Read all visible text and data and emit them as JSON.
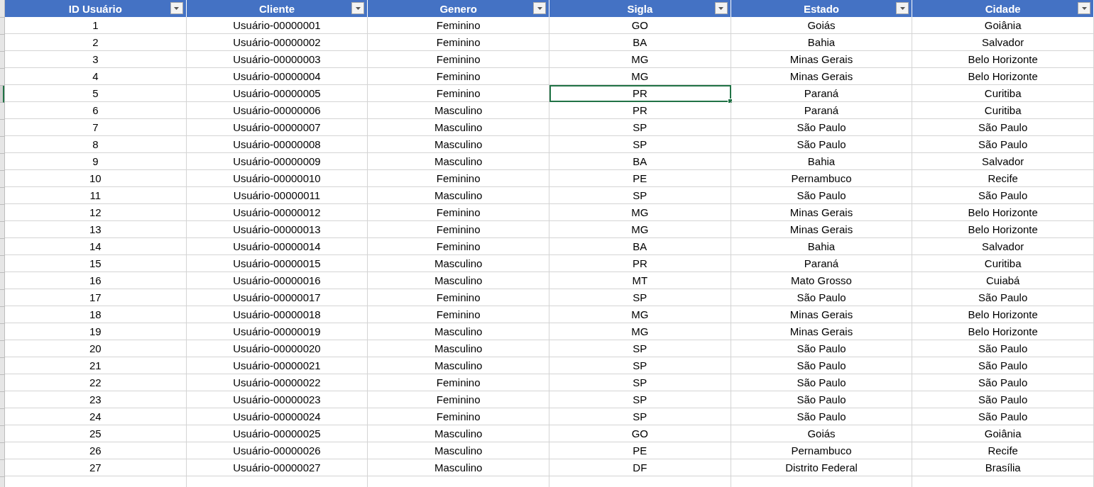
{
  "table": {
    "columns": [
      {
        "label": "ID Usuário",
        "selected": false
      },
      {
        "label": "Cliente",
        "selected": false
      },
      {
        "label": "Genero",
        "selected": false
      },
      {
        "label": "Sigla",
        "selected": true
      },
      {
        "label": "Estado",
        "selected": false
      },
      {
        "label": "Cidade",
        "selected": false
      }
    ],
    "rows": [
      {
        "selected": false,
        "cells": [
          "1",
          "Usuário-00000001",
          "Feminino",
          "GO",
          "Goiás",
          "Goiânia"
        ]
      },
      {
        "selected": false,
        "cells": [
          "2",
          "Usuário-00000002",
          "Feminino",
          "BA",
          "Bahia",
          "Salvador"
        ]
      },
      {
        "selected": false,
        "cells": [
          "3",
          "Usuário-00000003",
          "Feminino",
          "MG",
          "Minas Gerais",
          "Belo Horizonte"
        ]
      },
      {
        "selected": false,
        "cells": [
          "4",
          "Usuário-00000004",
          "Feminino",
          "MG",
          "Minas Gerais",
          "Belo Horizonte"
        ]
      },
      {
        "selected": true,
        "cells": [
          "5",
          "Usuário-00000005",
          "Feminino",
          "PR",
          "Paraná",
          "Curitiba"
        ]
      },
      {
        "selected": false,
        "cells": [
          "6",
          "Usuário-00000006",
          "Masculino",
          "PR",
          "Paraná",
          "Curitiba"
        ]
      },
      {
        "selected": false,
        "cells": [
          "7",
          "Usuário-00000007",
          "Masculino",
          "SP",
          "São Paulo",
          "São Paulo"
        ]
      },
      {
        "selected": false,
        "cells": [
          "8",
          "Usuário-00000008",
          "Masculino",
          "SP",
          "São Paulo",
          "São Paulo"
        ]
      },
      {
        "selected": false,
        "cells": [
          "9",
          "Usuário-00000009",
          "Masculino",
          "BA",
          "Bahia",
          "Salvador"
        ]
      },
      {
        "selected": false,
        "cells": [
          "10",
          "Usuário-00000010",
          "Feminino",
          "PE",
          "Pernambuco",
          "Recife"
        ]
      },
      {
        "selected": false,
        "cells": [
          "11",
          "Usuário-00000011",
          "Masculino",
          "SP",
          "São Paulo",
          "São Paulo"
        ]
      },
      {
        "selected": false,
        "cells": [
          "12",
          "Usuário-00000012",
          "Feminino",
          "MG",
          "Minas Gerais",
          "Belo Horizonte"
        ]
      },
      {
        "selected": false,
        "cells": [
          "13",
          "Usuário-00000013",
          "Feminino",
          "MG",
          "Minas Gerais",
          "Belo Horizonte"
        ]
      },
      {
        "selected": false,
        "cells": [
          "14",
          "Usuário-00000014",
          "Feminino",
          "BA",
          "Bahia",
          "Salvador"
        ]
      },
      {
        "selected": false,
        "cells": [
          "15",
          "Usuário-00000015",
          "Masculino",
          "PR",
          "Paraná",
          "Curitiba"
        ]
      },
      {
        "selected": false,
        "cells": [
          "16",
          "Usuário-00000016",
          "Masculino",
          "MT",
          "Mato Grosso",
          "Cuiabá"
        ]
      },
      {
        "selected": false,
        "cells": [
          "17",
          "Usuário-00000017",
          "Feminino",
          "SP",
          "São Paulo",
          "São Paulo"
        ]
      },
      {
        "selected": false,
        "cells": [
          "18",
          "Usuário-00000018",
          "Feminino",
          "MG",
          "Minas Gerais",
          "Belo Horizonte"
        ]
      },
      {
        "selected": false,
        "cells": [
          "19",
          "Usuário-00000019",
          "Masculino",
          "MG",
          "Minas Gerais",
          "Belo Horizonte"
        ]
      },
      {
        "selected": false,
        "cells": [
          "20",
          "Usuário-00000020",
          "Masculino",
          "SP",
          "São Paulo",
          "São Paulo"
        ]
      },
      {
        "selected": false,
        "cells": [
          "21",
          "Usuário-00000021",
          "Masculino",
          "SP",
          "São Paulo",
          "São Paulo"
        ]
      },
      {
        "selected": false,
        "cells": [
          "22",
          "Usuário-00000022",
          "Feminino",
          "SP",
          "São Paulo",
          "São Paulo"
        ]
      },
      {
        "selected": false,
        "cells": [
          "23",
          "Usuário-00000023",
          "Feminino",
          "SP",
          "São Paulo",
          "São Paulo"
        ]
      },
      {
        "selected": false,
        "cells": [
          "24",
          "Usuário-00000024",
          "Feminino",
          "SP",
          "São Paulo",
          "São Paulo"
        ]
      },
      {
        "selected": false,
        "cells": [
          "25",
          "Usuário-00000025",
          "Masculino",
          "GO",
          "Goiás",
          "Goiânia"
        ]
      },
      {
        "selected": false,
        "cells": [
          "26",
          "Usuário-00000026",
          "Masculino",
          "PE",
          "Pernambuco",
          "Recife"
        ]
      },
      {
        "selected": false,
        "cells": [
          "27",
          "Usuário-00000027",
          "Masculino",
          "DF",
          "Distrito Federal",
          "Brasília"
        ]
      }
    ]
  }
}
